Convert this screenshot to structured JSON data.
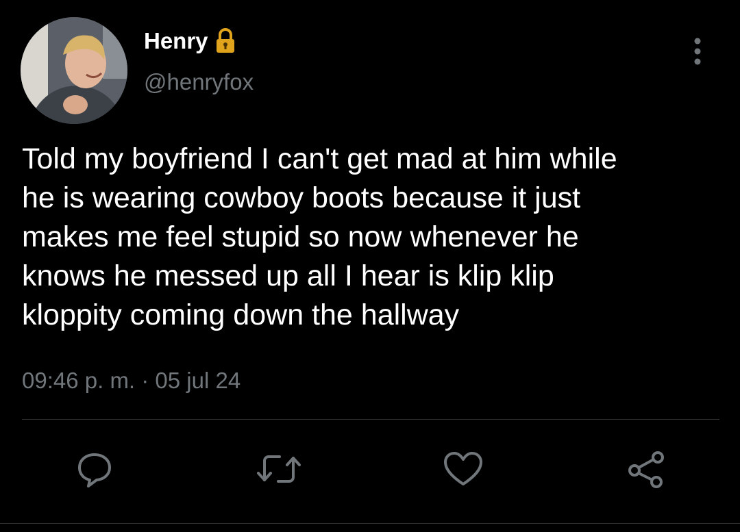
{
  "user": {
    "display_name": "Henry",
    "handle": "@henryfox",
    "protected_icon": "lock-icon",
    "avatar": "profile-photo"
  },
  "tweet": {
    "text": "Told my boyfriend I can't get mad at him while\nhe is wearing cowboy boots because it just\nmakes me feel stupid so now whenever he\nknows he messed up all I hear is klip klip\nkloppity coming down the hallway",
    "timestamp": "09:46 p. m. · 05 jul 24"
  },
  "actions": [
    {
      "icon": "reply-icon"
    },
    {
      "icon": "retweet-icon"
    },
    {
      "icon": "like-icon"
    },
    {
      "icon": "share-icon"
    }
  ],
  "menu": {
    "icon": "more-options-icon"
  },
  "colors": {
    "background": "#000000",
    "primary_text": "#ffffff",
    "secondary_text": "#71767b",
    "lock": "#e0a31c",
    "divider": "#2f3336"
  }
}
